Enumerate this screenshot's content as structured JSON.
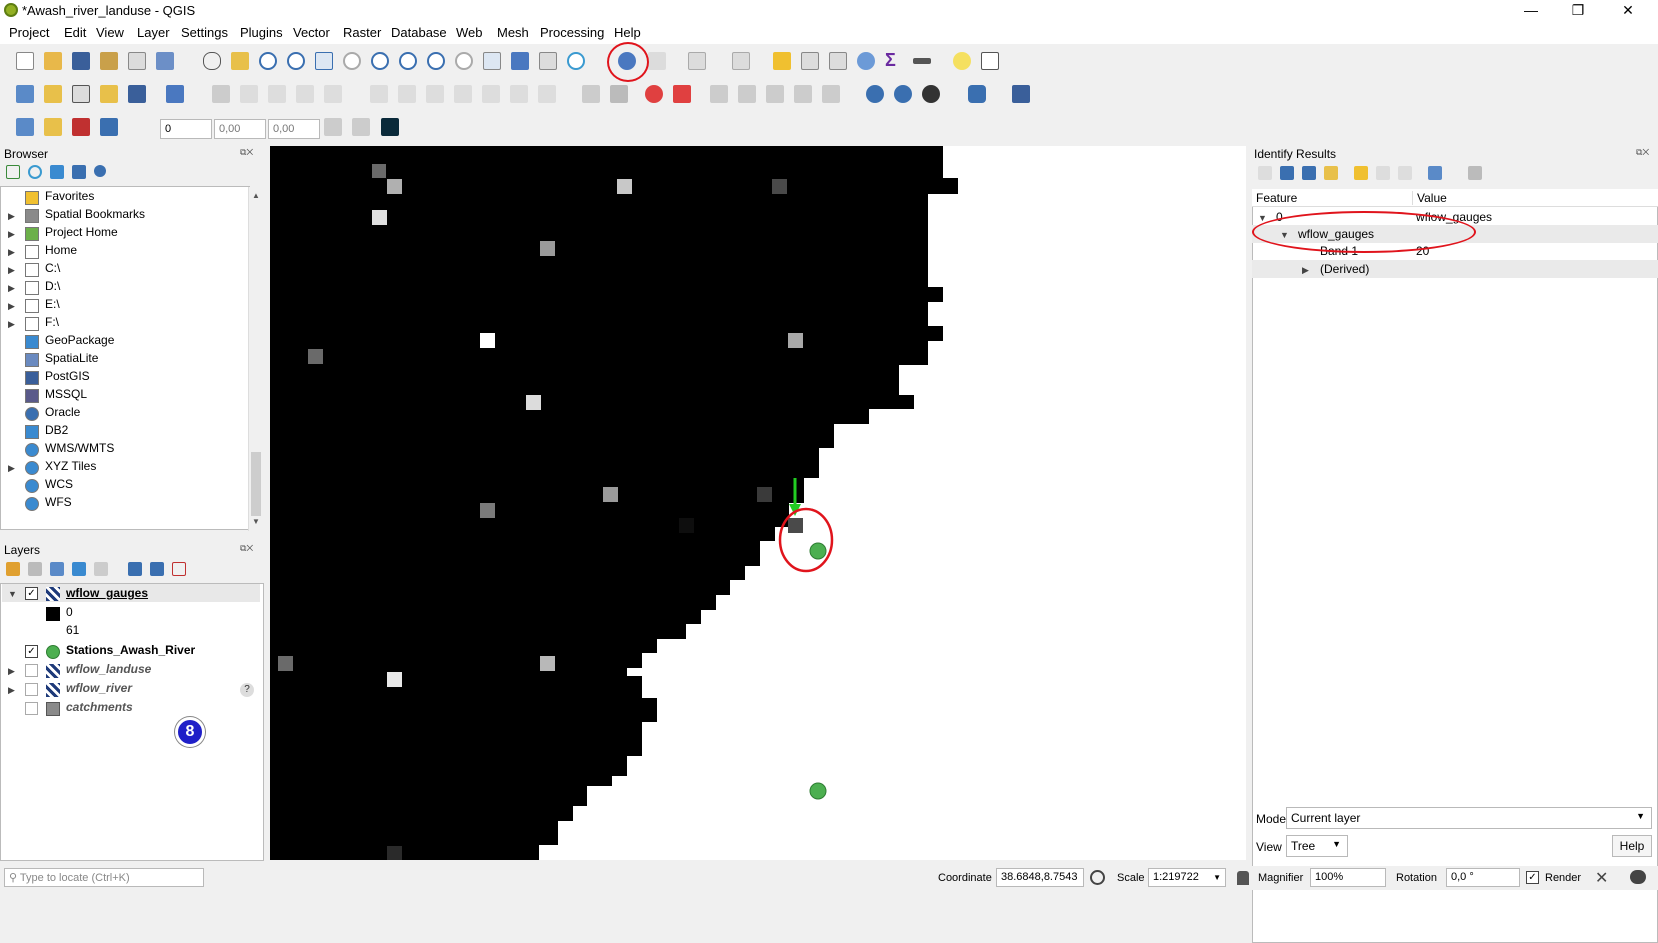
{
  "window": {
    "title": "*Awash_river_landuse - QGIS",
    "controls": [
      "—",
      "❐",
      "✕"
    ]
  },
  "menu": [
    "Project",
    "Edit",
    "View",
    "Layer",
    "Settings",
    "Plugins",
    "Vector",
    "Raster",
    "Database",
    "Web",
    "Mesh",
    "Processing",
    "Help"
  ],
  "toolbar3": {
    "value1": "0",
    "value2": "0,00",
    "value3": "0,00"
  },
  "browser": {
    "title": "Browser",
    "items": [
      {
        "label": "Favorites",
        "icon": "star-icon",
        "expandable": false
      },
      {
        "label": "Spatial Bookmarks",
        "icon": "bookmark-icon",
        "expandable": true
      },
      {
        "label": "Project Home",
        "icon": "project-home-icon",
        "expandable": true
      },
      {
        "label": "Home",
        "icon": "home-icon",
        "expandable": true
      },
      {
        "label": "C:\\",
        "icon": "folder-icon",
        "expandable": true
      },
      {
        "label": "D:\\",
        "icon": "folder-icon",
        "expandable": true
      },
      {
        "label": "E:\\",
        "icon": "folder-icon",
        "expandable": true
      },
      {
        "label": "F:\\",
        "icon": "folder-icon",
        "expandable": true
      },
      {
        "label": "GeoPackage",
        "icon": "geopackage-icon",
        "expandable": false
      },
      {
        "label": "SpatiaLite",
        "icon": "spatialite-icon",
        "expandable": false
      },
      {
        "label": "PostGIS",
        "icon": "postgis-icon",
        "expandable": false
      },
      {
        "label": "MSSQL",
        "icon": "mssql-icon",
        "expandable": false
      },
      {
        "label": "Oracle",
        "icon": "oracle-icon",
        "expandable": false
      },
      {
        "label": "DB2",
        "icon": "db2-icon",
        "expandable": false
      },
      {
        "label": "WMS/WMTS",
        "icon": "globe-icon",
        "expandable": false
      },
      {
        "label": "XYZ Tiles",
        "icon": "globe-icon",
        "expandable": true
      },
      {
        "label": "WCS",
        "icon": "globe-icon",
        "expandable": false
      },
      {
        "label": "WFS",
        "icon": "globe-icon",
        "expandable": false
      }
    ]
  },
  "layers": {
    "title": "Layers",
    "items": [
      {
        "name": "wflow_gauges",
        "checked": true,
        "style": "bold-underline",
        "legend": [
          "0",
          "61"
        ]
      },
      {
        "name": "Stations_Awash_River",
        "checked": true,
        "style": "bold"
      },
      {
        "name": "wflow_landuse",
        "checked": false,
        "style": "italic"
      },
      {
        "name": "wflow_river",
        "checked": false,
        "style": "italic"
      },
      {
        "name": "catchments",
        "checked": false,
        "style": "italic"
      }
    ],
    "unknown_marker": "?",
    "badge": "8"
  },
  "identify": {
    "title": "Identify Results",
    "col_feature": "Feature",
    "col_value": "Value",
    "rows": [
      {
        "feature": "0",
        "value": "wflow_gauges"
      },
      {
        "feature": "wflow_gauges",
        "value": ""
      },
      {
        "feature": "Band 1",
        "value": "20"
      },
      {
        "feature": "(Derived)",
        "value": ""
      }
    ],
    "mode_label": "Mode",
    "mode_value": "Current layer",
    "view_label": "View",
    "view_value": "Tree",
    "help": "Help"
  },
  "status": {
    "locate_placeholder": "Type to locate (Ctrl+K)",
    "coordinate_label": "Coordinate",
    "coordinate_value": "38.6848,8.7543",
    "scale_label": "Scale",
    "scale_value": "1:219722",
    "magnifier_label": "Magnifier",
    "magnifier_value": "100%",
    "rotation_label": "Rotation",
    "rotation_value": "0,0 °",
    "render_label": "Render"
  },
  "colors": {
    "accent_red": "#e0141c",
    "station_green": "#4caf50",
    "arrow_green": "#22cc22"
  }
}
